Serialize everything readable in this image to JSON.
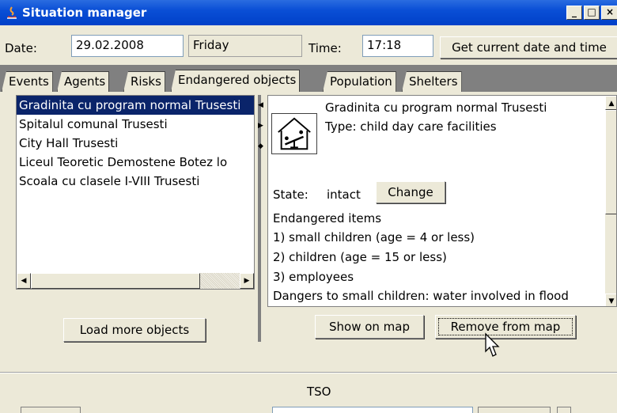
{
  "window": {
    "title": "Situation manager",
    "minimize": "_",
    "maximize": "□",
    "close": "×"
  },
  "date_row": {
    "date_label": "Date:",
    "date_value": "29.02.2008",
    "weekday": "Friday",
    "time_label": "Time:",
    "time_value": "17:18",
    "get_current_button": "Get current date and time"
  },
  "tabs": [
    {
      "label": "Events",
      "active": false
    },
    {
      "label": "Agents",
      "active": false
    },
    {
      "label": "Risks",
      "active": false
    },
    {
      "label": "Endangered objects",
      "active": true
    },
    {
      "label": "Population",
      "active": false
    },
    {
      "label": "Shelters",
      "active": false
    }
  ],
  "objects_list": [
    {
      "label": "Gradinita cu program normal Trusesti",
      "selected": true
    },
    {
      "label": "Spitalul comunal Trusesti",
      "selected": false
    },
    {
      "label": "City Hall Trusesti",
      "selected": false
    },
    {
      "label": "Liceul Teoretic Demostene Botez lo",
      "selected": false
    },
    {
      "label": "Scoala cu clasele I-VIII Trusesti",
      "selected": false
    }
  ],
  "detail": {
    "object_name": "Gradinita cu program normal Trusesti",
    "type_line": "Type: child day care facilities",
    "icon": "child-care-icon",
    "state_label": "State:",
    "state_value": "intact",
    "change_button": "Change",
    "endangered_header": "Endangered items",
    "items": [
      "1) small children (age = 4 or less)",
      "2) children (age = 15 or less)",
      "3) employees"
    ],
    "dangers": "Dangers to small children: water involved in flood"
  },
  "buttons": {
    "load_more": "Load more objects",
    "show_on_map": "Show on map",
    "remove_from_map": "Remove from map"
  },
  "bottom": {
    "section_label": "TSO"
  },
  "colors": {
    "titlebar": "#0a4fd6",
    "selection": "#0a246a",
    "window_bg": "#ece9d8"
  }
}
